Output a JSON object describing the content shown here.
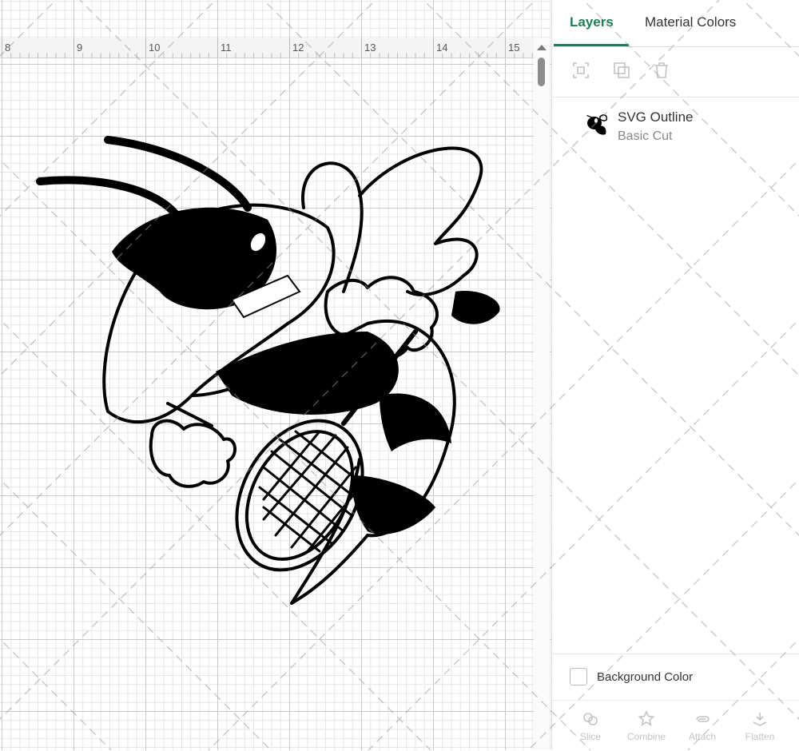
{
  "ruler": {
    "labels": [
      "8",
      "9",
      "10",
      "11",
      "12",
      "13",
      "14",
      "15"
    ]
  },
  "panel": {
    "tabs": [
      {
        "label": "Layers",
        "active": true
      },
      {
        "label": "Material Colors",
        "active": false
      }
    ],
    "toolbar": {
      "icons": [
        "group-icon",
        "duplicate-icon",
        "delete-icon"
      ]
    },
    "layers": [
      {
        "name": "SVG Outline",
        "type": "Basic Cut",
        "icon": "bee-mascot-thumbnail"
      }
    ],
    "background_color_label": "Background Color",
    "actions": [
      {
        "label": "Slice",
        "icon": "slice-icon"
      },
      {
        "label": "Combine",
        "icon": "combine-icon"
      },
      {
        "label": "Attach",
        "icon": "attach-icon"
      },
      {
        "label": "Flatten",
        "icon": "flatten-icon"
      }
    ]
  },
  "colors": {
    "accent": "#1b7e56",
    "text": "#333333",
    "muted": "#888888",
    "grid": "#c9c9c9"
  }
}
